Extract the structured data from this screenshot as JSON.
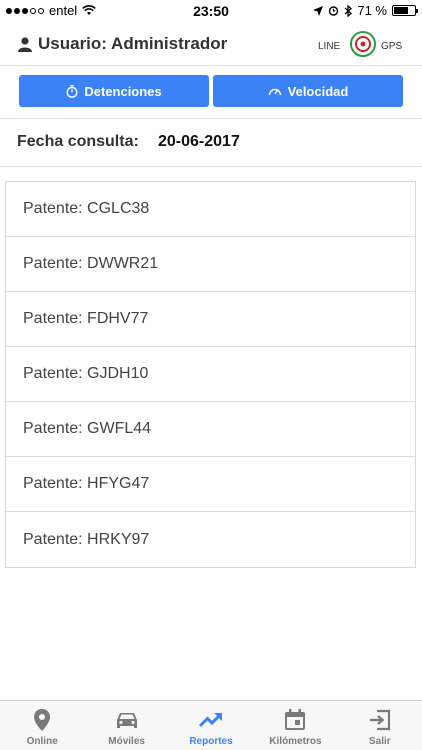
{
  "status": {
    "carrier": "entel",
    "time": "23:50",
    "battery_percent": "71 %",
    "battery_level": 0.71
  },
  "header": {
    "user_label": "Usuario: Administrador",
    "logo_text_left": "LINE",
    "logo_text_right": "GPS"
  },
  "buttons": [
    {
      "label": "Detenciones",
      "icon": "stopwatch-icon"
    },
    {
      "label": "Velocidad",
      "icon": "speedometer-icon"
    }
  ],
  "query": {
    "label": "Fecha consulta:",
    "date": "20-06-2017"
  },
  "patentes": [
    "Patente: CGLC38",
    "Patente: DWWR21",
    "Patente: FDHV77",
    "Patente: GJDH10",
    "Patente: GWFL44",
    "Patente: HFYG47",
    "Patente: HRKY97"
  ],
  "tabs": [
    {
      "label": "Online",
      "icon": "location-pin-icon",
      "active": false
    },
    {
      "label": "Móviles",
      "icon": "car-icon",
      "active": false
    },
    {
      "label": "Reportes",
      "icon": "trending-up-icon",
      "active": true
    },
    {
      "label": "Kilómetros",
      "icon": "calendar-icon",
      "active": false
    },
    {
      "label": "Salir",
      "icon": "exit-icon",
      "active": false
    }
  ],
  "colors": {
    "accent": "#3b82f6",
    "tab_inactive": "#7a7a7a"
  }
}
